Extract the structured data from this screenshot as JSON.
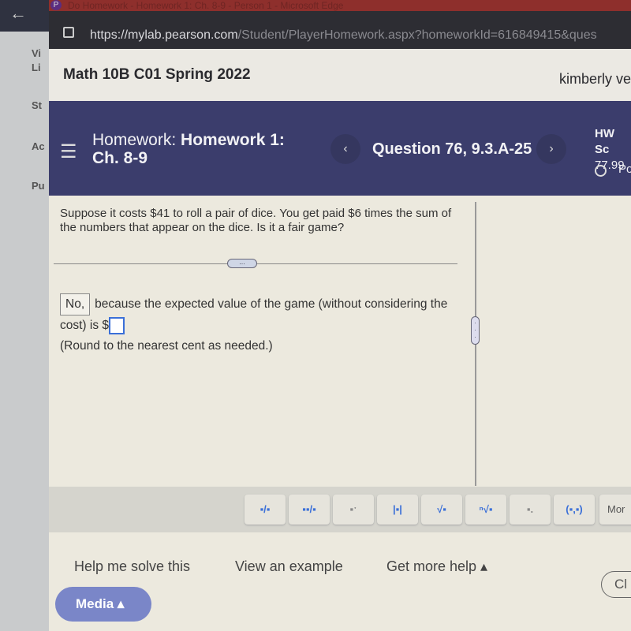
{
  "browser": {
    "window_title": "Do Homework - Homework 1: Ch. 8-9 - Person 1 - Microsoft Edge",
    "url_host": "https://mylab.pearson.com",
    "url_path": "/Student/PlayerHomework.aspx?homeworkId=616849415&ques"
  },
  "left_sidebar": {
    "items": [
      "Vi",
      "Li",
      "St",
      "Ac",
      "Pu"
    ]
  },
  "course": {
    "title": "Math 10B C01 Spring 2022",
    "user": "kimberly ve"
  },
  "nav": {
    "hw_prefix": "Homework:",
    "hw_name": "Homework 1:",
    "hw_name2": "Ch. 8-9",
    "question": "Question 76, 9.3.A-25",
    "prev": "‹",
    "next": "›",
    "score_label": "HW Sc",
    "score_value": "77.99",
    "points_label": "Po"
  },
  "question": {
    "text": "Suppose it costs $41 to roll a pair of dice. You get paid $6 times the sum of the numbers that appear on the dice. Is it a fair game?"
  },
  "answer": {
    "selected": "No,",
    "text1": "because the expected value of the game (without considering the cost) is $",
    "value": "",
    "note": "(Round to the nearest cent as needed.)"
  },
  "toolbar": {
    "tools": [
      "fraction",
      "mixed-number",
      "exponent",
      "absolute-value",
      "square-root",
      "nth-root",
      "subscript",
      "ordered-pair"
    ],
    "more": "Mor"
  },
  "footer": {
    "help": "Help me solve this",
    "example": "View an example",
    "more_help": "Get more help ▴",
    "media": "Media ▴",
    "clear": "Cl"
  }
}
